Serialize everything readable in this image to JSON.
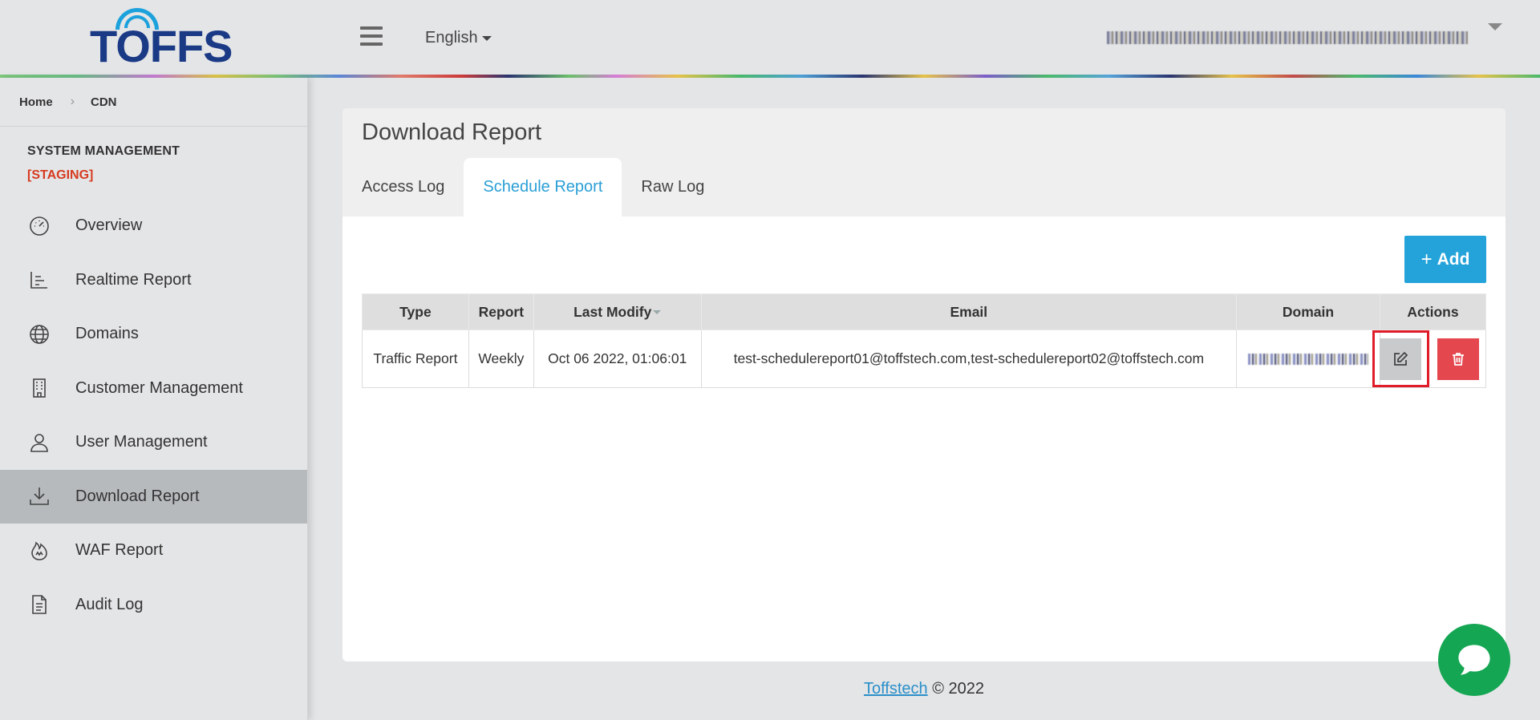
{
  "brand": {
    "logo_text": "TOFFS"
  },
  "header": {
    "language": "English",
    "user_redacted": true
  },
  "breadcrumb": {
    "home": "Home",
    "current": "CDN"
  },
  "sidebar": {
    "section_title": "SYSTEM MANAGEMENT",
    "environment": "[STAGING]",
    "items": [
      {
        "label": "Overview",
        "icon": "gauge-icon"
      },
      {
        "label": "Realtime Report",
        "icon": "line-chart-icon"
      },
      {
        "label": "Domains",
        "icon": "globe-icon"
      },
      {
        "label": "Customer Management",
        "icon": "building-icon"
      },
      {
        "label": "User Management",
        "icon": "user-icon"
      },
      {
        "label": "Download Report",
        "icon": "download-icon",
        "active": true
      },
      {
        "label": "WAF Report",
        "icon": "flame-icon"
      },
      {
        "label": "Audit Log",
        "icon": "document-icon"
      }
    ]
  },
  "main": {
    "title": "Download Report",
    "tabs": [
      {
        "label": "Access Log"
      },
      {
        "label": "Schedule Report",
        "active": true
      },
      {
        "label": "Raw Log"
      }
    ],
    "add_button": {
      "icon": "+",
      "label": "Add"
    },
    "table": {
      "headers": [
        "Type",
        "Report",
        "Last Modify",
        "Email",
        "Domain",
        "Actions"
      ],
      "rows": [
        {
          "type": "Traffic Report",
          "report": "Weekly",
          "last_modify": "Oct 06 2022, 01:06:01",
          "email": "test-schedulereport01@toffstech.com,test-schedulereport02@toffstech.com",
          "domain_redacted": true
        }
      ]
    }
  },
  "footer": {
    "company": "Toffstech",
    "copyright": "© 2022"
  },
  "colors": {
    "accent": "#23a3d9",
    "active_tab": "#2a9fd6",
    "staging": "#d63b1f",
    "delete": "#e5474f",
    "highlight": "#e11c2a",
    "chat": "#14a652"
  }
}
